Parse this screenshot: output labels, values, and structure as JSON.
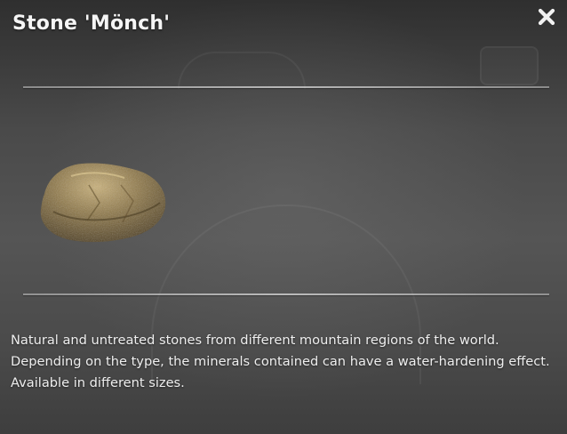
{
  "item": {
    "title": "Stone 'Mönch'",
    "description": "Natural and untreated stones from different mountain regions of the world. Depending on the type, the minerals contained can have a water-hardening effect. Available in different sizes.",
    "image": "stone-image"
  },
  "controls": {
    "close_icon": "close-icon"
  },
  "colors": {
    "text": "#eeeeee",
    "stone_base": "#8a7444",
    "stone_highlight": "#c4ab72",
    "stone_shadow": "#4e3f22"
  }
}
